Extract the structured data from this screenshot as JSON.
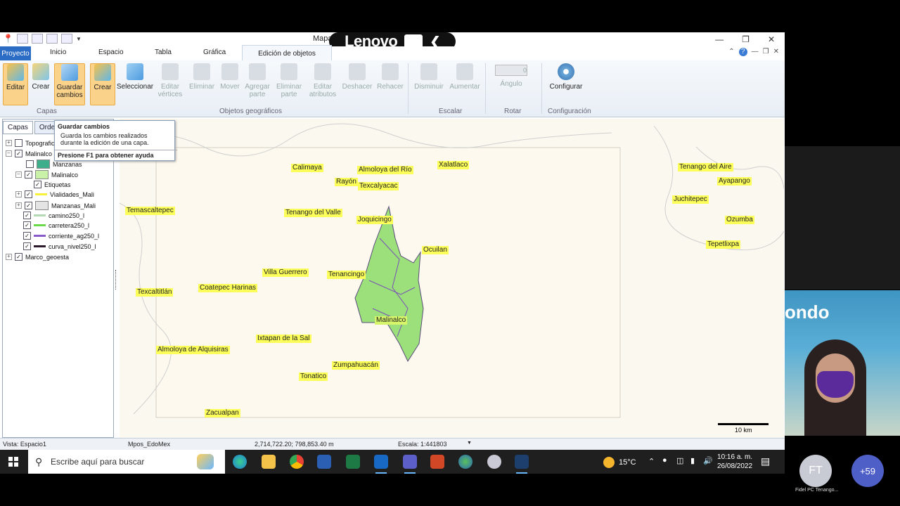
{
  "window": {
    "title_partial": "Mapa",
    "overlay_brand": "Lenovo",
    "overlay_suffix": "1"
  },
  "ribbon_tabs": [
    {
      "label": "Proyecto",
      "active_app_tab": true
    },
    {
      "label": "Inicio"
    },
    {
      "label": "Espacio"
    },
    {
      "label": "Tabla"
    },
    {
      "label": "Gráfica"
    },
    {
      "label": "Edición de objetos",
      "selected": true
    }
  ],
  "ribbon": {
    "editar": "Editar",
    "crear1": "Crear",
    "guardar": "Guardar cambios",
    "crear2": "Crear",
    "seleccionar": "Seleccionar",
    "editar_vertices": "Editar vértices",
    "eliminar": "Eliminar",
    "mover": "Mover",
    "agregar_parte": "Agregar parte",
    "eliminar_parte": "Eliminar parte",
    "editar_atributos": "Editar atributos",
    "deshacer": "Deshacer",
    "rehacer": "Rehacer",
    "disminuir": "Disminuir",
    "aumentar": "Aumentar",
    "angulo_value": "0",
    "angulo_label": "Ángulo",
    "configurar": "Configurar",
    "groups": {
      "capas": "Capas",
      "objetos": "Objetos geográficos",
      "escalar": "Escalar",
      "rotar": "Rotar",
      "configuracion": "Configuración"
    }
  },
  "left_panel": {
    "tab_capas": "Capas",
    "tab_orden": "Orden",
    "layers": [
      {
        "name": "Topografic",
        "checked": false,
        "expander": "+"
      },
      {
        "name": "Malinalco",
        "checked": true,
        "expander": "-"
      },
      {
        "name": "Manzanas",
        "checked": false,
        "swatch": "#3fae8a"
      },
      {
        "name": "Malinalco",
        "checked": true,
        "swatch": "#c9f2a8",
        "expander": "-"
      },
      {
        "name": "Etiquetas",
        "checked": true
      },
      {
        "name": "Vialidades_Mali",
        "checked": true,
        "line": "#f6f03a",
        "expander": "+"
      },
      {
        "name": "Manzanas_Mali",
        "checked": true,
        "swatch": "#e4e4e4",
        "expander": "+"
      },
      {
        "name": "camino250_l",
        "checked": true,
        "line": "#b5d9b5"
      },
      {
        "name": "carretera250_l",
        "checked": true,
        "line": "#6ad94a"
      },
      {
        "name": "corriente_ag250_l",
        "checked": true,
        "line": "#8a5ac8"
      },
      {
        "name": "curva_nivel250_l",
        "checked": true,
        "line": "#2a1a2a"
      },
      {
        "name": "Marco_geoesta",
        "checked": true,
        "expander": "+"
      }
    ]
  },
  "tooltip": {
    "title": "Guardar cambios",
    "description": "Guarda los cambios realizados durante la edición de una capa.",
    "footer": "Presione F1 para obtener ayuda"
  },
  "map_labels": [
    "Calimaya",
    "Almoloya del Río",
    "Xalatlaco",
    "Rayón",
    "Texcalyacac",
    "Temascaltepec",
    "Tenango del Valle",
    "Joquicingo",
    "Ocuilan",
    "Villa Guerrero",
    "Tenancingo",
    "Texcaltitlán",
    "Coatepec Harinas",
    "Malinalco",
    "Ixtapan de la Sal",
    "Almoloya de Alquisiras",
    "Zumpahuacán",
    "Tonatico",
    "Zacualpan",
    "Tenango del Aire",
    "Ayapango",
    "Juchitepec",
    "Ozumba",
    "Tepetlixpa"
  ],
  "scale_bar_label": "10 km",
  "status_bar": {
    "view": "Vista: Espacio1",
    "layer": "Mpos_EdoMex",
    "coords": "2,714,722.20; 798,853.40 m",
    "scale": "Escala: 1:441803"
  },
  "taskbar": {
    "search_placeholder": "Escribe aquí para buscar",
    "temperature": "15°C",
    "time": "10:16 a. m.",
    "date": "26/08/2022"
  },
  "meeting": {
    "caption_partial": "ondo",
    "avatar_initials": "FT",
    "avatar_name": "Fidel PC Tenango...",
    "more_participants": "+59"
  }
}
